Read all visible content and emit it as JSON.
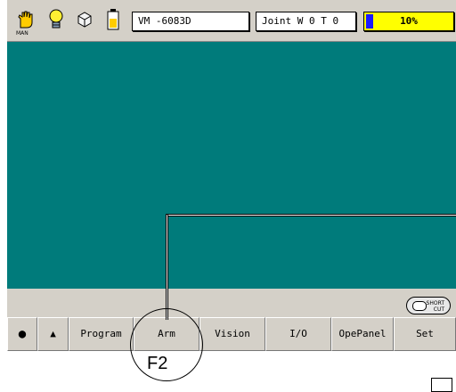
{
  "status": {
    "mode_label": "MAN",
    "program_field": "VM  -6083D",
    "coord_field": "Joint  W 0 T 0",
    "speed_percent": 10,
    "speed_text": "10%"
  },
  "shortcut": {
    "label_line1": "SHORT",
    "label_line2": "CUT"
  },
  "fkeys": [
    {
      "label": "●"
    },
    {
      "label": "▲"
    },
    {
      "label": "Program"
    },
    {
      "label": "Arm"
    },
    {
      "label": "Vision"
    },
    {
      "label": "I/O"
    },
    {
      "label": "OpePanel"
    },
    {
      "label": "Set"
    }
  ],
  "callout": {
    "label": "F2"
  },
  "colors": {
    "main_bg": "#007b7b",
    "speed_bg": "#ffff00",
    "speed_fill": "#1a1aff"
  }
}
